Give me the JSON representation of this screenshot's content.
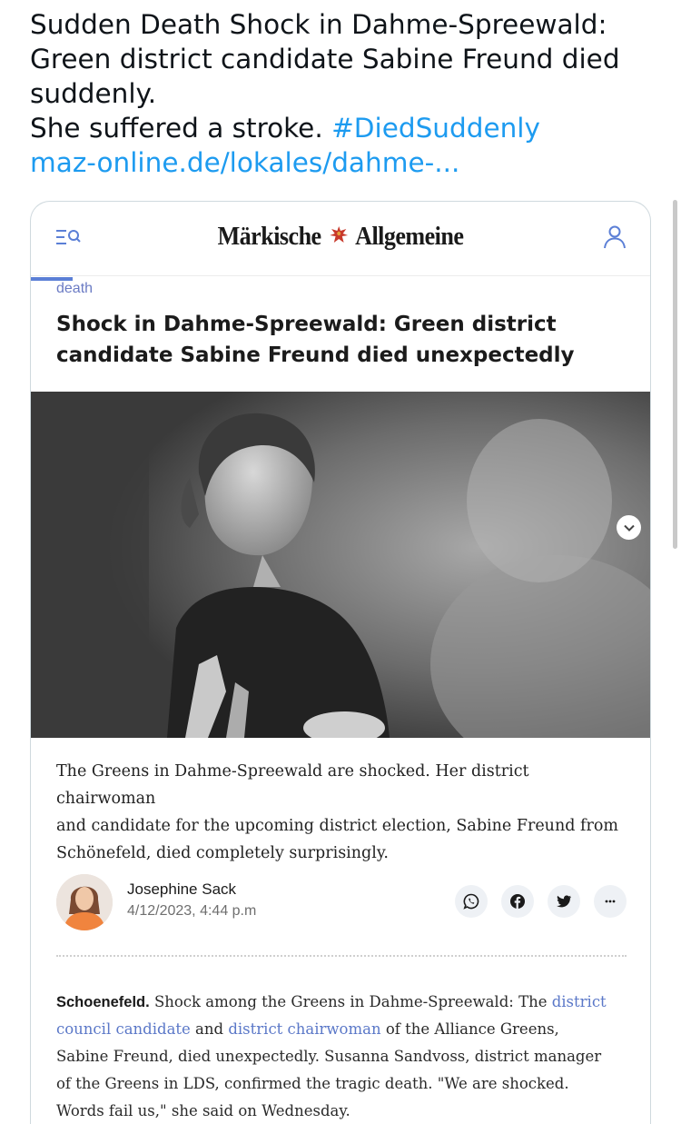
{
  "tweet": {
    "line1": "Sudden Death Shock in Dahme-Spreewald:",
    "line2": "Green district candidate Sabine Freund died",
    "line3": "suddenly.",
    "line4_text": "She suffered a stroke. ",
    "hashtag": "#DiedSuddenly",
    "link": "maz-online.de/lokales/dahme-..."
  },
  "card": {
    "header": {
      "logo_left": "Märkische",
      "logo_right": "Allgemeine",
      "icons": [
        "menu-search-icon",
        "eagle-crest-icon",
        "user-icon"
      ]
    },
    "category": "death",
    "headline_line1": "Shock in Dahme-Spreewald: Green district",
    "headline_line2": "candidate Sabine Freund died unexpectedly",
    "teaser_line1": "The Greens in Dahme-Spreewald are shocked. Her district chairwoman",
    "teaser_line2": "and candidate for the upcoming district election, Sabine Freund from",
    "teaser_line3": "Schönefeld, died completely surprisingly.",
    "author": {
      "name": "Josephine Sack",
      "date": "4/12/2023, 4:44 p.m"
    },
    "share_icons": [
      "whatsapp-icon",
      "facebook-icon",
      "twitter-icon",
      "more-icon"
    ],
    "body": {
      "dateline": "Schoenefeld.",
      "text1": " Shock among the Greens in Dahme-Spreewald: The ",
      "link1": "district council candidate",
      "text2": " and ",
      "link2": "district chairwoman",
      "text3": " of the Alliance Greens,",
      "line3": "Sabine Freund, died unexpectedly. Susanna Sandvoss, district manager",
      "line4": "of the Greens in LDS, confirmed the tragic death. \"We are shocked.",
      "line5": "Words fail us,\" she said on Wednesday."
    },
    "colors": {
      "accent": "#5b7fd6",
      "link": "#1d9bf0",
      "category": "#6b7bc4",
      "share_bg": "#eef1f5"
    }
  }
}
